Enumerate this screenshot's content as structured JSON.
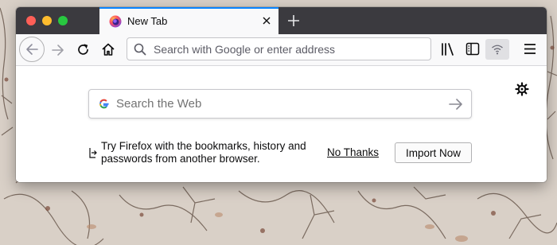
{
  "tab": {
    "title": "New Tab",
    "favicon_icon": "firefox-logo-icon",
    "close_icon": "close-icon"
  },
  "toolbar": {
    "back_icon": "back-arrow-icon",
    "forward_icon": "forward-arrow-icon",
    "reload_icon": "reload-icon",
    "home_icon": "home-icon",
    "new_tab_icon": "plus-icon",
    "library_icon": "library-icon",
    "sidebar_icon": "sidebar-icon",
    "wifi_icon": "wifi-icon",
    "menu_icon": "hamburger-menu-icon"
  },
  "urlbar": {
    "placeholder": "Search with Google or enter address",
    "value": ""
  },
  "newtab": {
    "settings_icon": "gear-icon",
    "search_placeholder": "Search the Web",
    "search_value": "",
    "import_message": "Try Firefox with the bookmarks, history and passwords from another browser.",
    "no_thanks_label": "No Thanks",
    "import_button_label": "Import Now"
  },
  "colors": {
    "accent": "#0a84ff",
    "tabstrip": "#3b3a3f",
    "toolbar": "#f9f9fa"
  }
}
